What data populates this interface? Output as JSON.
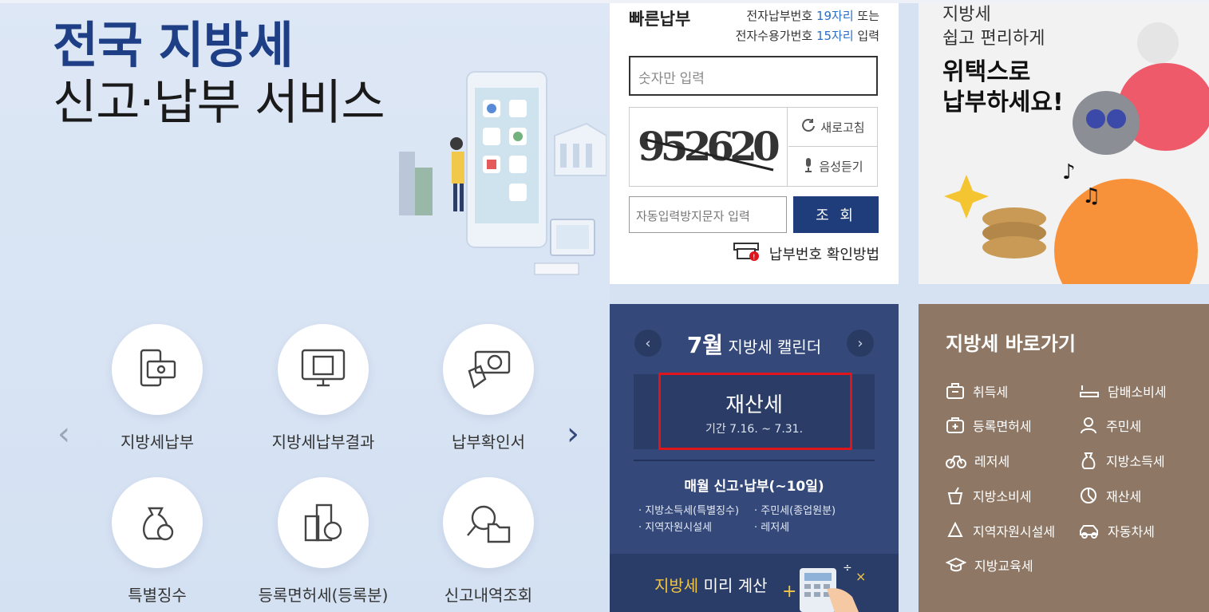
{
  "hero": {
    "title_line1": "전국 지방세",
    "title_line2": "신고·납부 서비스"
  },
  "services": {
    "prev_arrow": "‹",
    "next_arrow": "›",
    "items": [
      {
        "label": "지방세납부",
        "icon": "card-payment-icon"
      },
      {
        "label": "지방세납부결과",
        "icon": "monitor-documents-icon"
      },
      {
        "label": "납부확인서",
        "icon": "receipt-won-icon"
      },
      {
        "label": "특별징수",
        "icon": "money-bag-won-icon"
      },
      {
        "label": "등록면허세(등록분)",
        "icon": "building-won-icon"
      },
      {
        "label": "신고내역조회",
        "icon": "magnifier-folder-icon"
      }
    ]
  },
  "quick_pay": {
    "title": "빠른납부",
    "hint_line1_pre": "전자납부번호 ",
    "hint_line1_hl": "19자리",
    "hint_line1_post": " 또는",
    "hint_line2_pre": "전자수용가번호 ",
    "hint_line2_hl": "15자리",
    "hint_line2_post": " 입력",
    "number_placeholder": "숫자만 입력",
    "captcha_text": "952620",
    "refresh_label": "새로고침",
    "audio_label": "음성듣기",
    "captcha_placeholder": "자동입력방지문자 입력",
    "search_label": "조 회",
    "howto_label": "납부번호 확인방법"
  },
  "ad": {
    "line1": "지방세",
    "line2": "쉽고 편리하게",
    "line3": "위택스로",
    "line4": "납부하세요!"
  },
  "calendar": {
    "month": "7월",
    "title": " 지방세 캘린더",
    "prev": "‹",
    "next": "›",
    "event_title": "재산세",
    "event_period": "기간 7.16. ~ 7.31.",
    "monthly_title": "매월 신고·납부(~10일)",
    "monthly_items": [
      "지방소득세(특별징수)",
      "주민세(종업원분)",
      "지역자원시설세",
      "레저세"
    ],
    "calc_highlight": "지방세",
    "calc_text": " 미리 계산"
  },
  "shortcuts": {
    "title": "지방세 바로가기",
    "items": [
      {
        "label": "취득세",
        "icon": "briefcase-icon"
      },
      {
        "label": "담배소비세",
        "icon": "cigarette-icon"
      },
      {
        "label": "등록면허세",
        "icon": "medical-kit-icon"
      },
      {
        "label": "주민세",
        "icon": "person-icon"
      },
      {
        "label": "레저세",
        "icon": "bicycle-icon"
      },
      {
        "label": "지방소득세",
        "icon": "money-bag-icon"
      },
      {
        "label": "지방소비세",
        "icon": "drink-cup-icon"
      },
      {
        "label": "재산세",
        "icon": "pie-chart-icon"
      },
      {
        "label": "지역자원시설세",
        "icon": "recycle-icon"
      },
      {
        "label": "자동차세",
        "icon": "car-icon"
      },
      {
        "label": "지방교육세",
        "icon": "graduation-cap-icon"
      }
    ]
  },
  "colors": {
    "brand_navy": "#1e3f86",
    "calendar_bg": "#34497a",
    "shortcut_bg": "#8e7865",
    "highlight_red": "#e0141b",
    "link_blue": "#2a6ec7"
  }
}
